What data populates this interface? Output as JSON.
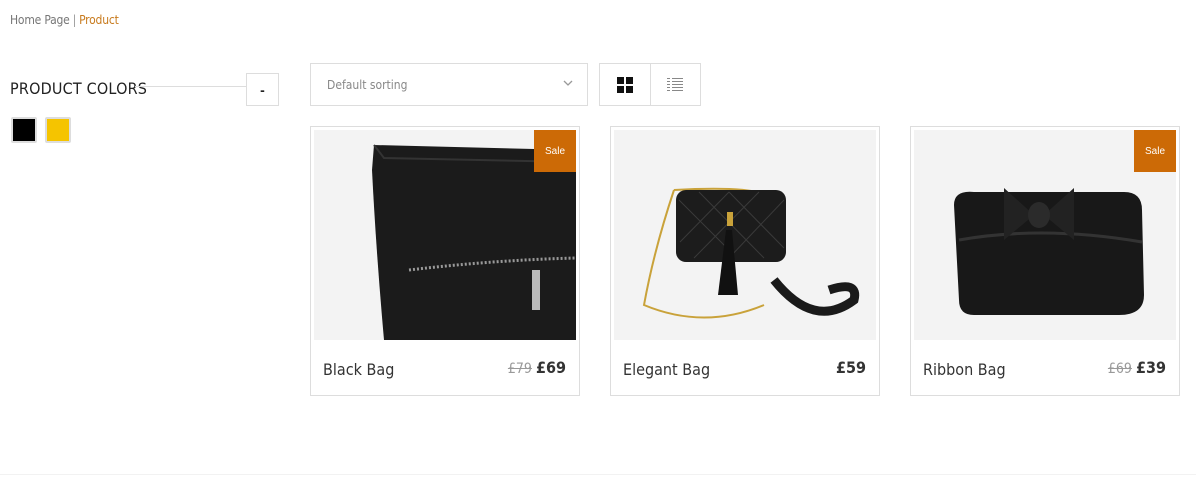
{
  "breadcrumb": {
    "home": "Home Page",
    "separator": "|",
    "current": "Product"
  },
  "sidebar": {
    "title": "PRODUCT COLORS",
    "collapse_label": "-",
    "colors": [
      {
        "name": "black",
        "hex": "#000000"
      },
      {
        "name": "yellow",
        "hex": "#f5c400"
      }
    ]
  },
  "toolbar": {
    "sort_value": "Default sorting",
    "views": [
      "grid-view-icon",
      "list-view-icon"
    ]
  },
  "products": [
    {
      "name": "Black Bag",
      "old_price": "£79",
      "price": "£69",
      "badge": "Sale"
    },
    {
      "name": "Elegant Bag",
      "old_price": "",
      "price": "£59",
      "badge": ""
    },
    {
      "name": "Ribbon Bag",
      "old_price": "£69",
      "price": "£39",
      "badge": "Sale"
    }
  ],
  "colors": {
    "accent": "#c87b1e",
    "badge": "#cc6a06",
    "border": "#dddddd"
  }
}
